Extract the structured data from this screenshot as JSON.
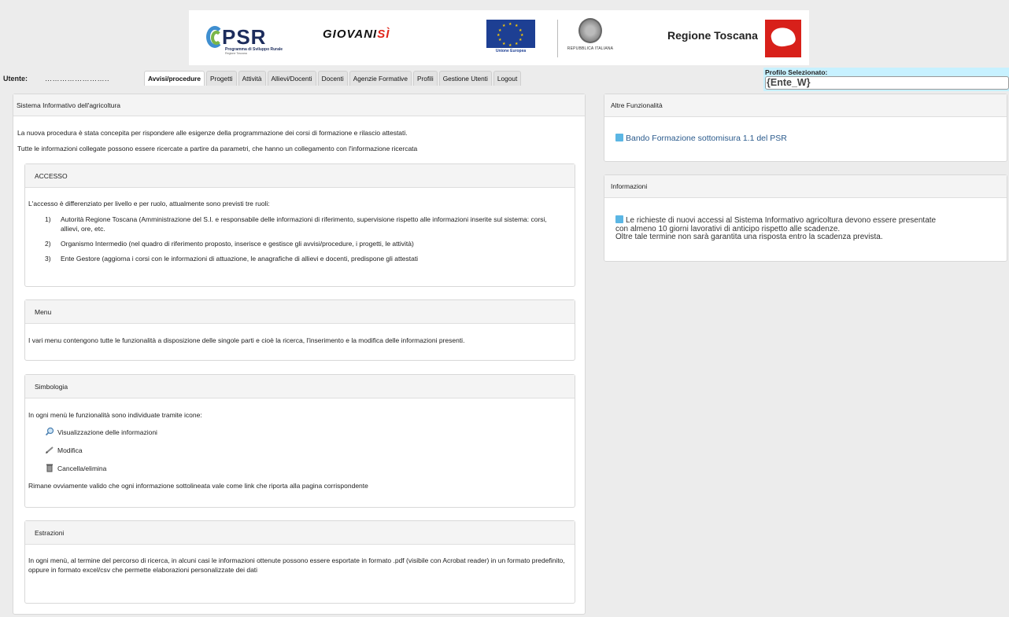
{
  "header": {
    "psr_logo": "PSR",
    "psr_subtitle": "Programma di Sviluppo Rurale",
    "psr_subtitle2": "Regione Toscana",
    "giovani_logo_a": "GIOVANI",
    "giovani_logo_b": "SÌ",
    "eu_label": "Unione Europea",
    "repubblica_label": "REPUBBLICA ITALIANA",
    "regione_label": "Regione Toscana"
  },
  "navbar": {
    "utente_label": "Utente:",
    "utente_value": "……………………..",
    "tabs": [
      {
        "label": "Avvisi/procedure",
        "active": true
      },
      {
        "label": "Progetti"
      },
      {
        "label": "Attività"
      },
      {
        "label": "Allievi/Docenti"
      },
      {
        "label": "Docenti"
      },
      {
        "label": "Agenzie Formative"
      },
      {
        "label": "Profili"
      },
      {
        "label": "Gestione Utenti"
      },
      {
        "label": "Logout"
      }
    ],
    "profile_label": "Profilo Selezionato:",
    "profile_value": "{Ente_W}"
  },
  "main": {
    "title": "Sistema Informativo dell'agricoltura",
    "intro1": "La nuova procedura è stata concepita per rispondere alle esigenze della programmazione dei corsi di formazione e rilascio attestati.",
    "intro2": "Tutte le informazioni collegate possono essere ricercate a partire da parametri, che hanno un collegamento con l'informazione ricercata",
    "accesso": {
      "title": "ACCESSO",
      "intro": "L'accesso è differenziato per livello e per ruolo, attualmente sono previsti tre ruoli:",
      "items": [
        {
          "num": "1)",
          "text": "Autorità Regione Toscana (Amministrazione del S.I. e responsabile delle informazioni di riferimento, supervisione rispetto alle informazioni inserite sul sistema: corsi, allievi, ore, etc."
        },
        {
          "num": "2)",
          "text": "Organismo Intermedio (nel quadro di riferimento proposto, inserisce e gestisce gli avvisi/procedure, i progetti, le attività)"
        },
        {
          "num": "3)",
          "text": "Ente Gestore (aggiorna i corsi con le informazioni di attuazione, le anagrafiche di allievi e docenti, predispone gli attestati"
        }
      ]
    },
    "menu": {
      "title": "Menu",
      "text": "I vari menu contengono tutte le funzionalità a disposizione delle singole parti e cioè la ricerca, l'inserimento e la modifica delle informazioni presenti."
    },
    "simbologia": {
      "title": "Simbologia",
      "intro": "In ogni menù le funzionalità sono individuate tramite icone:",
      "items": [
        {
          "icon": "magnifier-icon",
          "label": "Visualizzazione delle informazioni"
        },
        {
          "icon": "pencil-icon",
          "label": "Modifica"
        },
        {
          "icon": "trash-icon",
          "label": "Cancella/elimina"
        }
      ],
      "footer": "Rimane ovviamente valido che ogni informazione sottolineata vale come link che riporta alla pagina corrispondente"
    },
    "estrazioni": {
      "title": "Estrazioni",
      "text": "In ogni menù, al termine del percorso di ricerca, in alcuni casi le informazioni ottenute possono essere esportate in formato .pdf (visibile con Acrobat reader) in un formato predefinito, oppure in formato excel/csv che permette elaborazioni personalizzate dei dati"
    }
  },
  "side": {
    "altre_title": "Altre Funzionalità",
    "altre_link": "Bando Formazione sottomisura 1.1 del PSR",
    "info_title": "Informazioni",
    "info_line1": "Le richieste di nuovi accessi al Sistema Informativo agricoltura devono essere presentate",
    "info_line2": "con almeno 10 giorni lavorativi di anticipo rispetto alle scadenze.",
    "info_line3": "Oltre tale termine non sarà garantita una risposta entro la scadenza prevista."
  },
  "colors": {
    "page_bg": "#ececec",
    "profile_bg": "#c7f1ff",
    "link": "#2a5a8c",
    "bullet": "#5bb6e4",
    "toscana_red": "#d8201a",
    "eu_blue": "#1d3f93"
  }
}
